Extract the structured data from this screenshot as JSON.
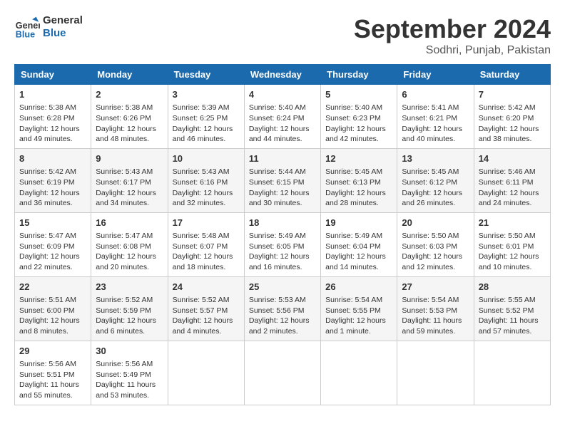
{
  "header": {
    "logo_line1": "General",
    "logo_line2": "Blue",
    "month": "September 2024",
    "location": "Sodhri, Punjab, Pakistan"
  },
  "weekdays": [
    "Sunday",
    "Monday",
    "Tuesday",
    "Wednesday",
    "Thursday",
    "Friday",
    "Saturday"
  ],
  "weeks": [
    [
      {
        "day": "1",
        "info": "Sunrise: 5:38 AM\nSunset: 6:28 PM\nDaylight: 12 hours and 49 minutes."
      },
      {
        "day": "2",
        "info": "Sunrise: 5:38 AM\nSunset: 6:26 PM\nDaylight: 12 hours and 48 minutes."
      },
      {
        "day": "3",
        "info": "Sunrise: 5:39 AM\nSunset: 6:25 PM\nDaylight: 12 hours and 46 minutes."
      },
      {
        "day": "4",
        "info": "Sunrise: 5:40 AM\nSunset: 6:24 PM\nDaylight: 12 hours and 44 minutes."
      },
      {
        "day": "5",
        "info": "Sunrise: 5:40 AM\nSunset: 6:23 PM\nDaylight: 12 hours and 42 minutes."
      },
      {
        "day": "6",
        "info": "Sunrise: 5:41 AM\nSunset: 6:21 PM\nDaylight: 12 hours and 40 minutes."
      },
      {
        "day": "7",
        "info": "Sunrise: 5:42 AM\nSunset: 6:20 PM\nDaylight: 12 hours and 38 minutes."
      }
    ],
    [
      {
        "day": "8",
        "info": "Sunrise: 5:42 AM\nSunset: 6:19 PM\nDaylight: 12 hours and 36 minutes."
      },
      {
        "day": "9",
        "info": "Sunrise: 5:43 AM\nSunset: 6:17 PM\nDaylight: 12 hours and 34 minutes."
      },
      {
        "day": "10",
        "info": "Sunrise: 5:43 AM\nSunset: 6:16 PM\nDaylight: 12 hours and 32 minutes."
      },
      {
        "day": "11",
        "info": "Sunrise: 5:44 AM\nSunset: 6:15 PM\nDaylight: 12 hours and 30 minutes."
      },
      {
        "day": "12",
        "info": "Sunrise: 5:45 AM\nSunset: 6:13 PM\nDaylight: 12 hours and 28 minutes."
      },
      {
        "day": "13",
        "info": "Sunrise: 5:45 AM\nSunset: 6:12 PM\nDaylight: 12 hours and 26 minutes."
      },
      {
        "day": "14",
        "info": "Sunrise: 5:46 AM\nSunset: 6:11 PM\nDaylight: 12 hours and 24 minutes."
      }
    ],
    [
      {
        "day": "15",
        "info": "Sunrise: 5:47 AM\nSunset: 6:09 PM\nDaylight: 12 hours and 22 minutes."
      },
      {
        "day": "16",
        "info": "Sunrise: 5:47 AM\nSunset: 6:08 PM\nDaylight: 12 hours and 20 minutes."
      },
      {
        "day": "17",
        "info": "Sunrise: 5:48 AM\nSunset: 6:07 PM\nDaylight: 12 hours and 18 minutes."
      },
      {
        "day": "18",
        "info": "Sunrise: 5:49 AM\nSunset: 6:05 PM\nDaylight: 12 hours and 16 minutes."
      },
      {
        "day": "19",
        "info": "Sunrise: 5:49 AM\nSunset: 6:04 PM\nDaylight: 12 hours and 14 minutes."
      },
      {
        "day": "20",
        "info": "Sunrise: 5:50 AM\nSunset: 6:03 PM\nDaylight: 12 hours and 12 minutes."
      },
      {
        "day": "21",
        "info": "Sunrise: 5:50 AM\nSunset: 6:01 PM\nDaylight: 12 hours and 10 minutes."
      }
    ],
    [
      {
        "day": "22",
        "info": "Sunrise: 5:51 AM\nSunset: 6:00 PM\nDaylight: 12 hours and 8 minutes."
      },
      {
        "day": "23",
        "info": "Sunrise: 5:52 AM\nSunset: 5:59 PM\nDaylight: 12 hours and 6 minutes."
      },
      {
        "day": "24",
        "info": "Sunrise: 5:52 AM\nSunset: 5:57 PM\nDaylight: 12 hours and 4 minutes."
      },
      {
        "day": "25",
        "info": "Sunrise: 5:53 AM\nSunset: 5:56 PM\nDaylight: 12 hours and 2 minutes."
      },
      {
        "day": "26",
        "info": "Sunrise: 5:54 AM\nSunset: 5:55 PM\nDaylight: 12 hours and 1 minute."
      },
      {
        "day": "27",
        "info": "Sunrise: 5:54 AM\nSunset: 5:53 PM\nDaylight: 11 hours and 59 minutes."
      },
      {
        "day": "28",
        "info": "Sunrise: 5:55 AM\nSunset: 5:52 PM\nDaylight: 11 hours and 57 minutes."
      }
    ],
    [
      {
        "day": "29",
        "info": "Sunrise: 5:56 AM\nSunset: 5:51 PM\nDaylight: 11 hours and 55 minutes."
      },
      {
        "day": "30",
        "info": "Sunrise: 5:56 AM\nSunset: 5:49 PM\nDaylight: 11 hours and 53 minutes."
      },
      null,
      null,
      null,
      null,
      null
    ]
  ]
}
